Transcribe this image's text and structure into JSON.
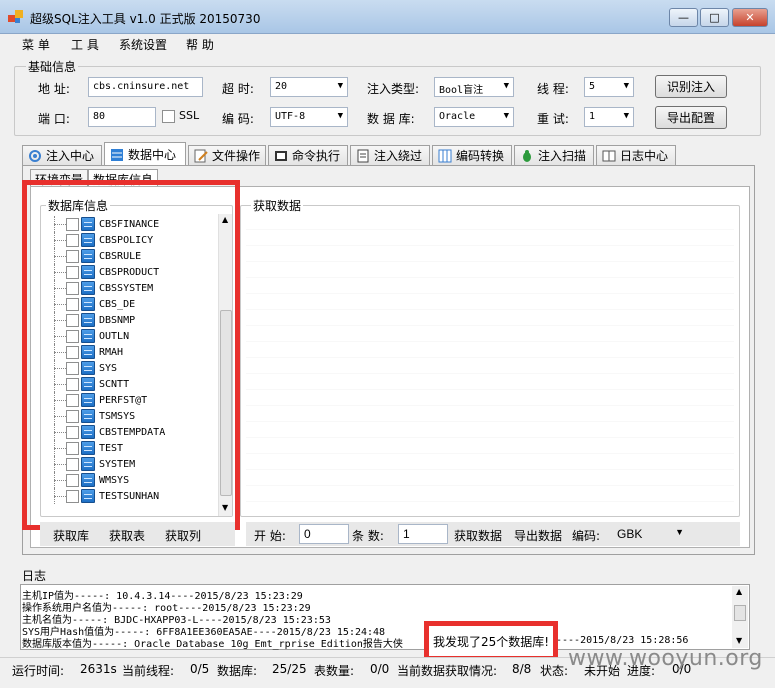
{
  "window": {
    "title": "超级SQL注入工具 v1.0 正式版 20150730",
    "minimize": "—",
    "maximize": "□",
    "close": "✕"
  },
  "menu": [
    "菜 单",
    "工 具",
    "系统设置",
    "帮 助"
  ],
  "basic": {
    "group_title": "基础信息",
    "address_label": "地 址:",
    "address_value": "cbs.cninsure.net",
    "port_label": "端 口:",
    "port_value": "80",
    "ssl_label": "SSL",
    "timeout_label": "超 时:",
    "timeout_value": "20",
    "encoding_label": "编 码:",
    "encoding_value": "UTF-8",
    "inject_type_label": "注入类型:",
    "inject_type_value": "Bool盲注",
    "database_label": "数 据 库:",
    "database_value": "Oracle",
    "threads_label": "线 程:",
    "threads_value": "5",
    "retry_label": "重 试:",
    "retry_value": "1",
    "identify_button": "识别注入",
    "export_config_button": "导出配置"
  },
  "tabs": [
    "注入中心",
    "数据中心",
    "文件操作",
    "命令执行",
    "注入绕过",
    "编码转换",
    "注入扫描",
    "日志中心"
  ],
  "subtabs": [
    "环境变量",
    "数据库信息"
  ],
  "db_panel": {
    "title": "数据库信息",
    "databases": [
      "CBSFINANCE",
      "CBSPOLICY",
      "CBSRULE",
      "CBSPRODUCT",
      "CBSSYSTEM",
      "CBS_DE",
      "DBSNMP",
      "OUTLN",
      "RMAH",
      "SYS",
      "SCNTT",
      "PERFST@T",
      "TSMSYS",
      "CBSTEMPDATA",
      "TEST",
      "SYSTEM",
      "WMSYS",
      "TESTSUNHAN"
    ]
  },
  "data_panel": {
    "title": "获取数据"
  },
  "actions": {
    "get_db": "获取库",
    "get_table": "获取表",
    "get_column": "获取列",
    "start_label": "开 始:",
    "start_value": "0",
    "count_label": "条 数:",
    "count_value": "1",
    "fetch_data": "获取数据",
    "export_data": "导出数据",
    "encode_label": "编码:",
    "encode_value": "GBK"
  },
  "log": {
    "title": "日志",
    "lines": [
      "主机IP值为-----: 10.4.3.14----2015/8/23 15:23:29",
      "操作系统用户名值为-----: root----2015/8/23 15:23:29",
      "主机名值为-----: BJDC-HXAPP03-L----2015/8/23 15:23:53",
      "SYS用户Hash值值为-----: 6FF8A1EE360EA5AE----2015/8/23 15:24:48",
      "数据库版本值为-----: Oracle Database 10g Emt_rprise Edition报告大侠"
    ],
    "popup": "我发现了25个数据库!",
    "popup_suffix": "----2015/8/23 15:28:56"
  },
  "status": {
    "runtime_label": "运行时间:",
    "runtime_value": "2631s",
    "threads_label": "当前线程:",
    "threads_value": "0/5",
    "db_label": "数据库:",
    "db_value": "25/25",
    "tables_label": "表数量:",
    "tables_value": "0/0",
    "fetch_label": "当前数据获取情况:",
    "fetch_value": "8/8",
    "state_label": "状态:",
    "state_value": "未开始",
    "progress_label": "进度:",
    "progress_value": "0/0"
  },
  "watermark": "www.wooyun.org"
}
